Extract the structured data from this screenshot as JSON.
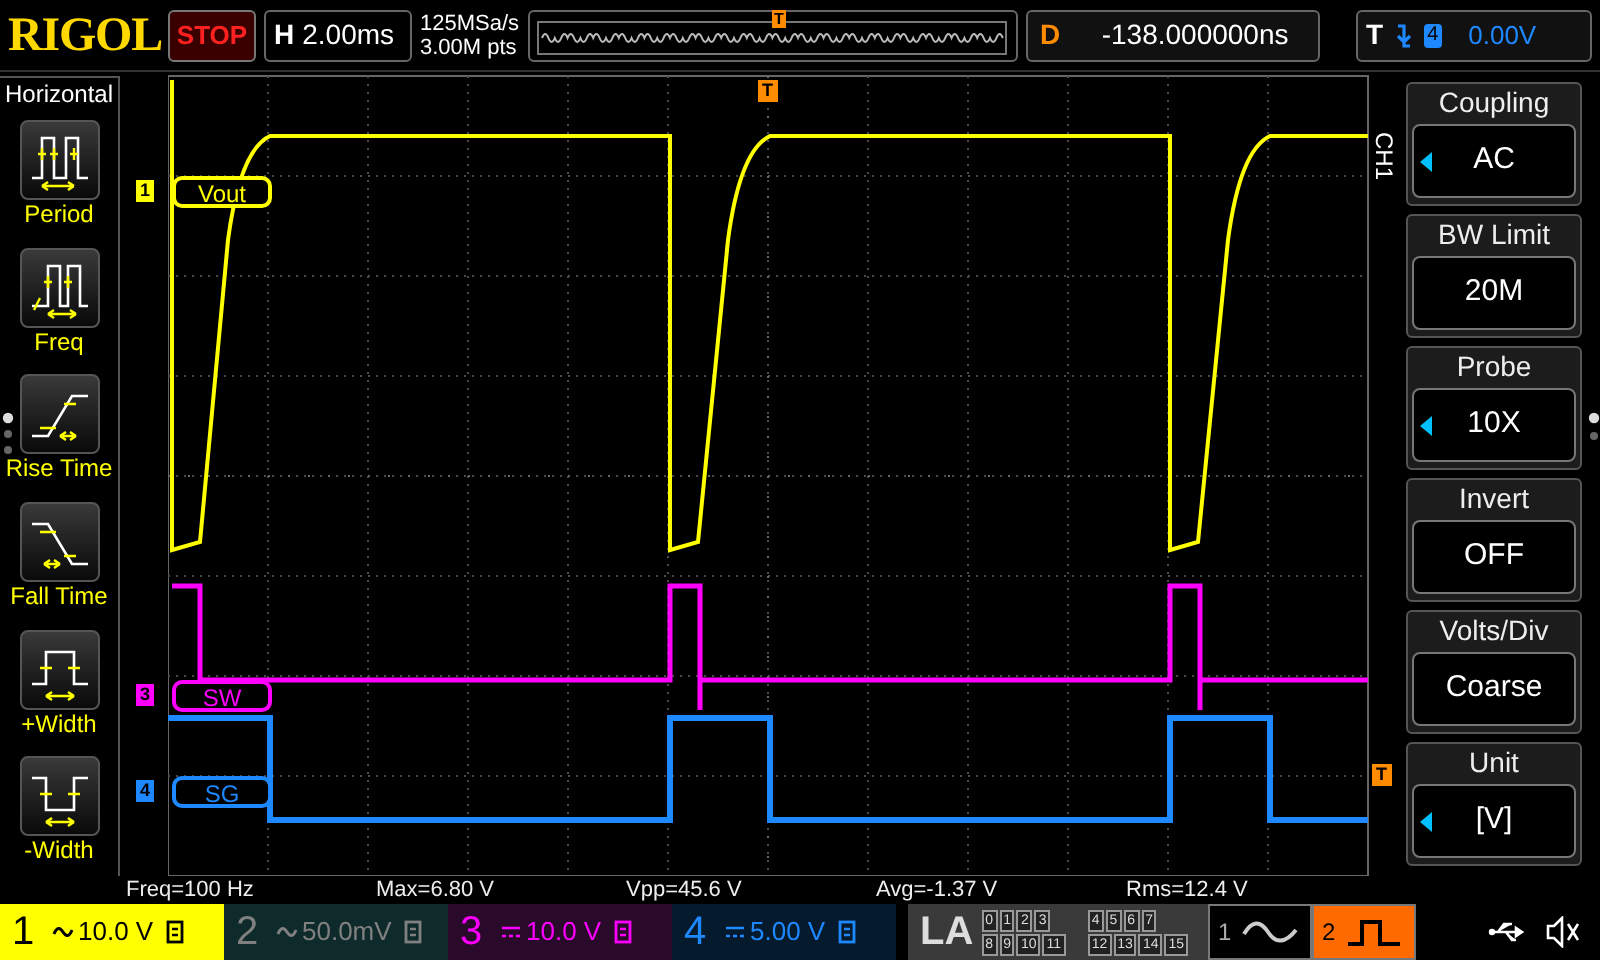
{
  "top_bar": {
    "logo": "RIGOL",
    "run_state": "STOP",
    "timebase": {
      "label": "H",
      "value": "2.00ms"
    },
    "sample_rate": "125MSa/s",
    "memory_depth": "3.00M pts",
    "overview_trigger": "T",
    "delay": {
      "label": "D",
      "value": "-138.000000ns"
    },
    "trigger": {
      "label": "T",
      "source": "4",
      "level": "0.00V"
    }
  },
  "left_menu": {
    "title": "Horizontal",
    "items": [
      {
        "kind": "period",
        "label": "Period"
      },
      {
        "kind": "freq",
        "label": "Freq"
      },
      {
        "kind": "rise",
        "label": "Rise Time"
      },
      {
        "kind": "fall",
        "label": "Fall Time"
      },
      {
        "kind": "pwidth",
        "label": "+Width"
      },
      {
        "kind": "nwidth",
        "label": "-Width"
      }
    ]
  },
  "screen": {
    "channel_labels": [
      {
        "number": "1",
        "label": "Vout",
        "color": "#ffff00"
      },
      {
        "number": "3",
        "label": "SW",
        "color": "#ff00ff"
      },
      {
        "number": "4",
        "label": "SG",
        "color": "#1e88ff"
      }
    ],
    "trigger_position_marker": "T",
    "trigger_level_marker": "T"
  },
  "right_menu": {
    "title": "CH1",
    "items": [
      {
        "label": "Coupling",
        "value": "AC",
        "adjustable": true
      },
      {
        "label": "BW Limit",
        "value": "20M",
        "adjustable": false
      },
      {
        "label": "Probe",
        "value": "10X",
        "adjustable": true
      },
      {
        "label": "Invert",
        "value": "OFF",
        "adjustable": false
      },
      {
        "label": "Volts/Div",
        "value": "Coarse",
        "adjustable": false
      },
      {
        "label": "Unit",
        "value": "[V]",
        "adjustable": true
      }
    ]
  },
  "measurements": [
    "Freq=100 Hz",
    "Max=6.80 V",
    "Vpp=45.6 V",
    "Avg=-1.37 V",
    "Rms=12.4 V"
  ],
  "channels": [
    {
      "number": "1",
      "kind": "ac",
      "scale": "10.0 V",
      "selected": true,
      "color": "#ffff00"
    },
    {
      "number": "2",
      "kind": "ac",
      "scale": "50.0mV",
      "selected": false,
      "color": "#808080"
    },
    {
      "number": "3",
      "kind": "dc",
      "scale": "10.0 V",
      "selected": false,
      "color": "#ff00ff"
    },
    {
      "number": "4",
      "kind": "dc",
      "scale": "5.00 V",
      "selected": false,
      "color": "#1e88ff"
    }
  ],
  "la": {
    "label": "LA",
    "groups": [
      [
        "0",
        "1",
        "2",
        "3"
      ],
      [
        "4",
        "5",
        "6",
        "7"
      ],
      [
        "8",
        "9",
        "10",
        "11"
      ],
      [
        "12",
        "13",
        "14",
        "15"
      ]
    ]
  },
  "sources": [
    {
      "number": "1",
      "kind": "sine",
      "selected": false
    },
    {
      "number": "2",
      "kind": "square",
      "selected": true
    }
  ]
}
